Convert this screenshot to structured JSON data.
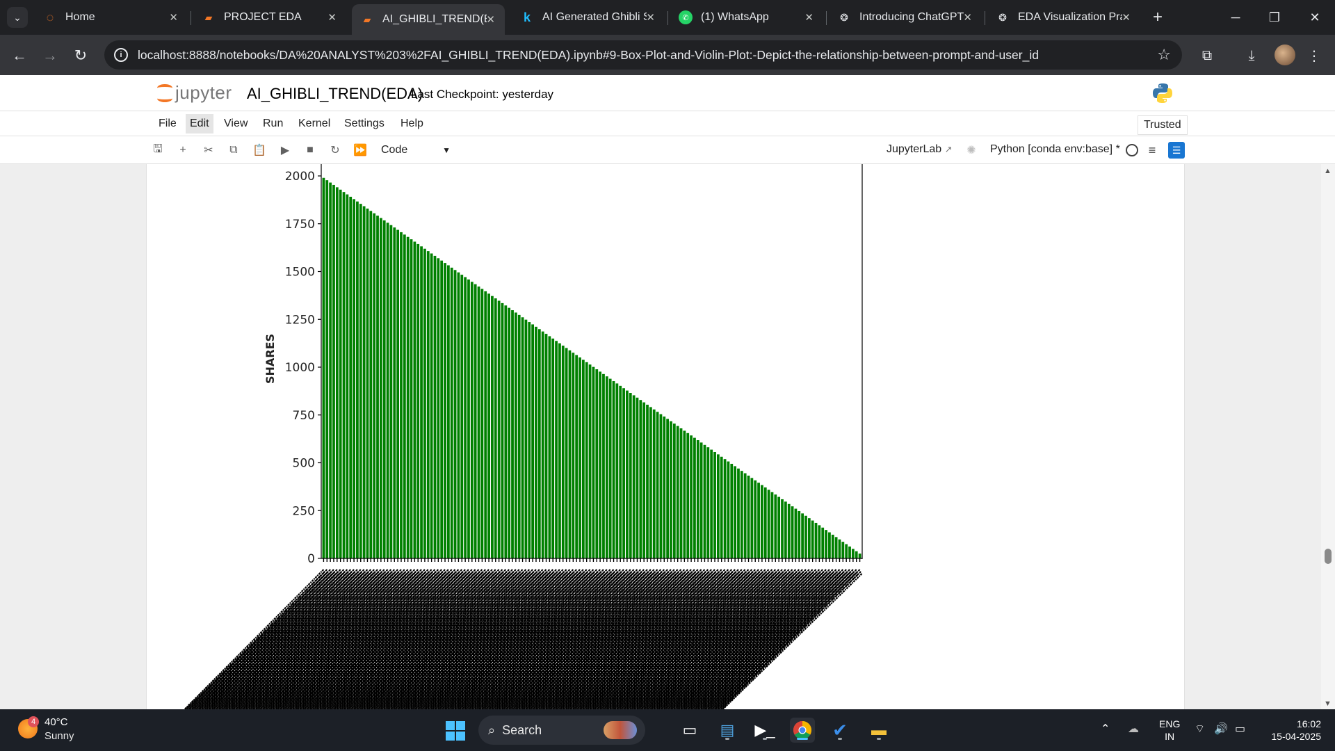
{
  "browser": {
    "tabs": [
      {
        "label": "Home",
        "icon": "jupyter-icon"
      },
      {
        "label": "PROJECT EDA",
        "icon": "notebook-icon"
      },
      {
        "label": "AI_GHIBLI_TREND(EDA)",
        "icon": "notebook-icon",
        "active": true
      },
      {
        "label": "AI Generated Ghibli Style",
        "icon": "kaggle-icon"
      },
      {
        "label": "(1) WhatsApp",
        "icon": "whatsapp-icon"
      },
      {
        "label": "Introducing ChatGPT",
        "icon": "openai-icon"
      },
      {
        "label": "EDA Visualization Practice",
        "icon": "openai-icon"
      }
    ],
    "url": "localhost:8888/notebooks/DA%20ANALYST%203%2FAI_GHIBLI_TREND(EDA).ipynb#9-Box-Plot-and-Violin-Plot:-Depict-the-relationship-between-prompt-and-user_id"
  },
  "jupyter": {
    "logo_text": "jupyter",
    "notebook_title": "AI_GHIBLI_TREND(EDA)",
    "checkpoint": "Last Checkpoint: yesterday",
    "menu": [
      "File",
      "Edit",
      "View",
      "Run",
      "Kernel",
      "Settings",
      "Help"
    ],
    "active_menu": "Edit",
    "trusted": "Trusted",
    "cell_type": "Code",
    "jupyterlab_link": "JupyterLab",
    "kernel": "Python [conda env:base] *"
  },
  "chart_data": {
    "type": "bar",
    "ylabel": "SHARES",
    "ylim": [
      0,
      2000
    ],
    "yticks": [
      0,
      250,
      500,
      750,
      1000,
      1250,
      1500,
      1750,
      2000
    ],
    "bar_color": "#008000",
    "n_bars": 160,
    "values_start": 1990,
    "values_end": 25,
    "xtick_labels": "overlapping, illegible"
  },
  "taskbar": {
    "weather_badge": "4",
    "temperature": "40°C",
    "condition": "Sunny",
    "search_label": "Search",
    "lang_top": "ENG",
    "lang_bottom": "IN",
    "time": "16:02",
    "date": "15-04-2025"
  }
}
